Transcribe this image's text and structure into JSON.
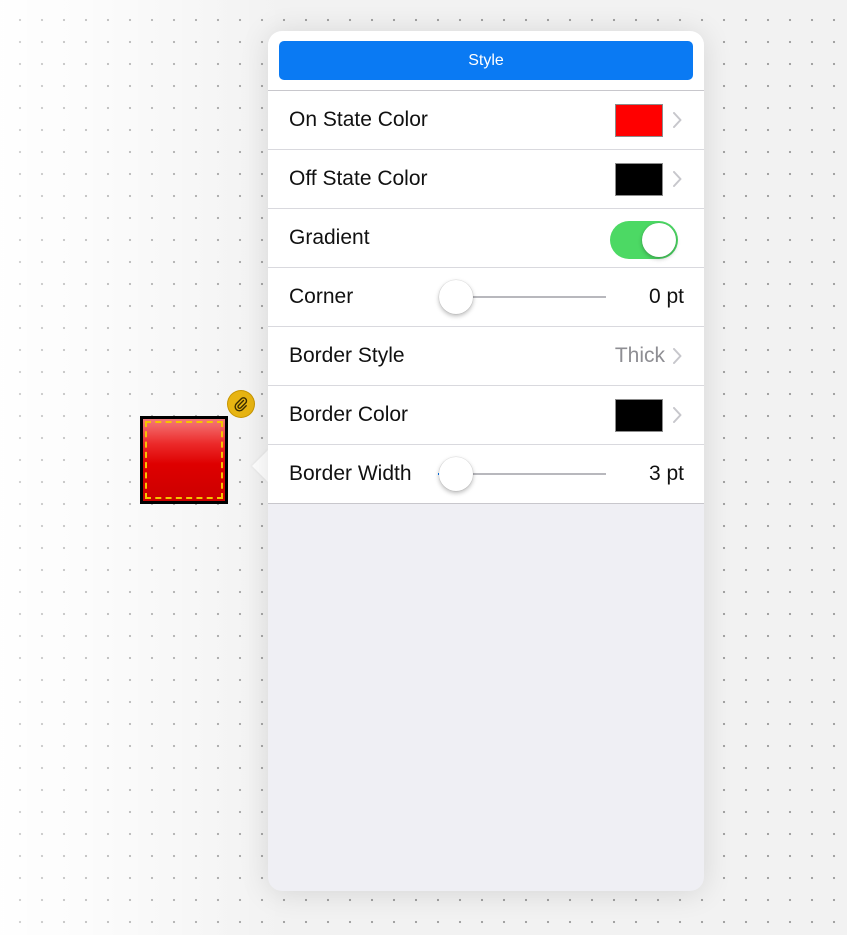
{
  "popover": {
    "header": {
      "style_label": "Style"
    },
    "rows": {
      "on_state_color": {
        "label": "On State Color",
        "color": "#ff0000"
      },
      "off_state_color": {
        "label": "Off State Color",
        "color": "#000000"
      },
      "gradient": {
        "label": "Gradient",
        "enabled": true
      },
      "corner": {
        "label": "Corner",
        "value": "0 pt",
        "slider_fraction": 0.0
      },
      "border_style": {
        "label": "Border Style",
        "value": "Thick"
      },
      "border_color": {
        "label": "Border Color",
        "color": "#000000"
      },
      "border_width": {
        "label": "Border Width",
        "value": "3 pt",
        "slider_fraction": 0.11
      }
    }
  },
  "canvas": {
    "selected_widget": {
      "fill_color": "#dd0000",
      "border_color": "#000000",
      "selection_color": "#f5c400",
      "badge_icon": "paperclip-icon"
    }
  },
  "colors": {
    "accent": "#0a7af3",
    "toggle_on": "#4cd964"
  }
}
